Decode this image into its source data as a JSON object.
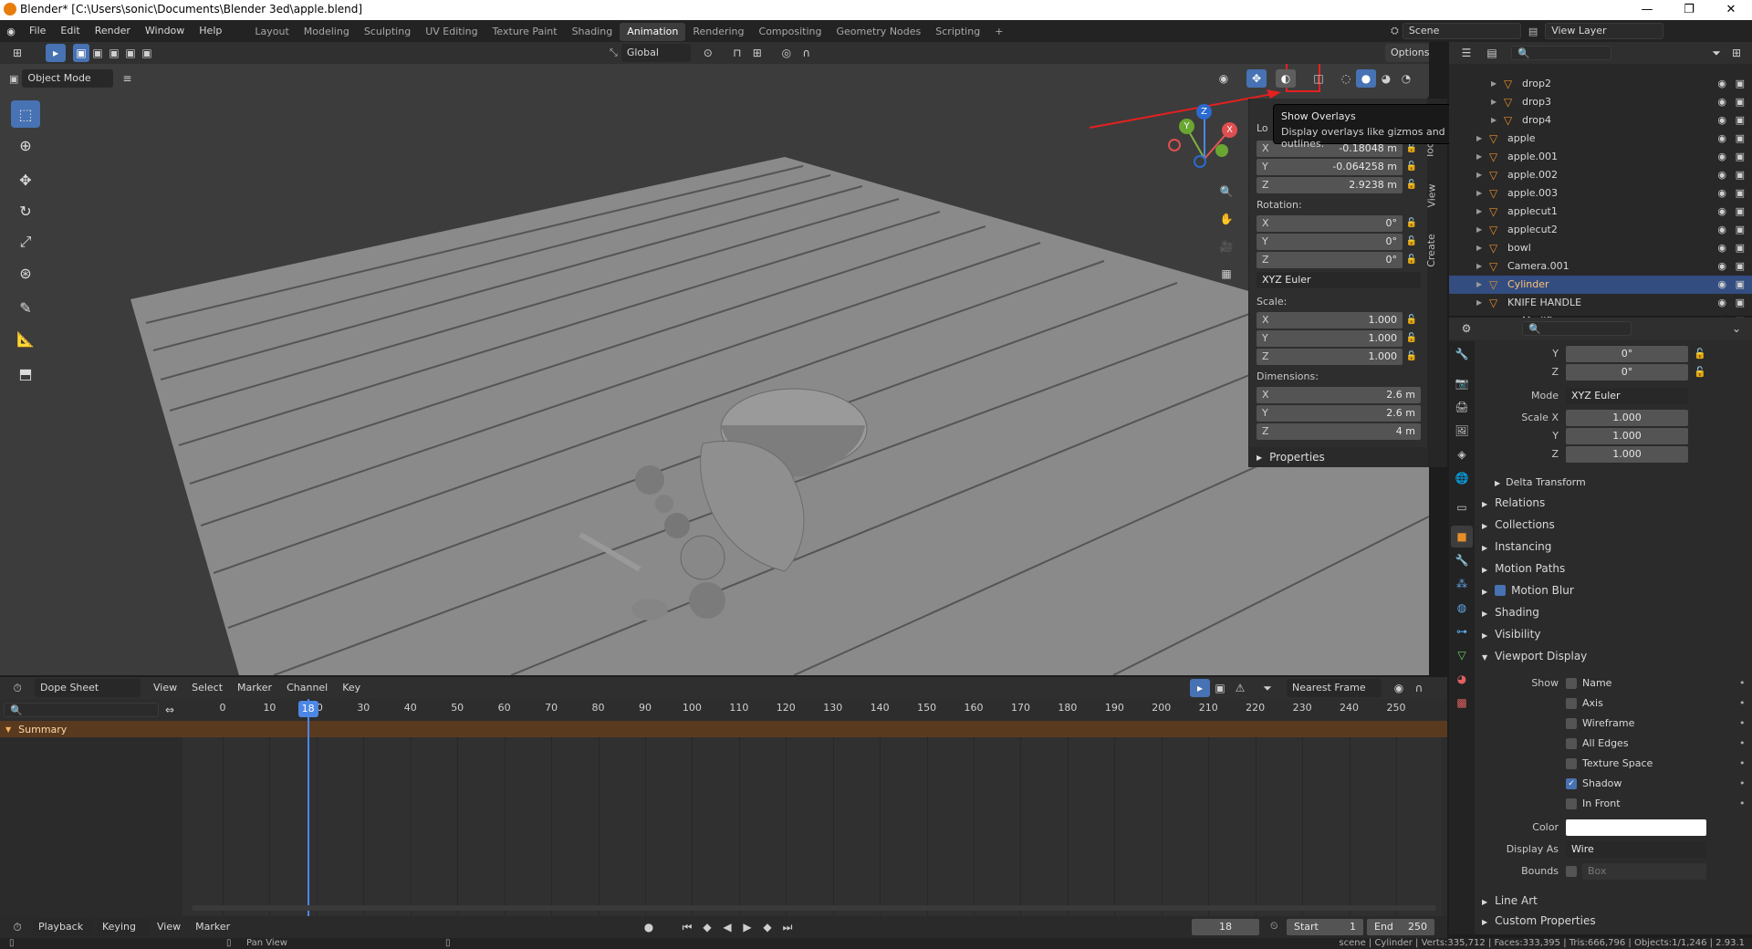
{
  "window": {
    "title": "Blender* [C:\\Users\\sonic\\Documents\\Blender 3ed\\apple.blend]",
    "minimize": "—",
    "maximize": "❐",
    "close": "✕"
  },
  "menu": {
    "items": [
      "File",
      "Edit",
      "Render",
      "Window",
      "Help"
    ],
    "workspaces": [
      "Layout",
      "Modeling",
      "Sculpting",
      "UV Editing",
      "Texture Paint",
      "Shading",
      "Animation",
      "Rendering",
      "Compositing",
      "Geometry Nodes",
      "Scripting"
    ],
    "active_workspace": "Animation",
    "add": "+",
    "scene": "Scene",
    "view_layer": "View Layer"
  },
  "viewport": {
    "mode": "Object Mode",
    "orientation": "Global",
    "options": "Options",
    "gizmo_labels": {
      "x": "X",
      "y": "Y",
      "z": "Z"
    }
  },
  "tooltip": {
    "title": "Show Overlays",
    "desc": "Display overlays like gizmos and outlines."
  },
  "npanel": {
    "location_label": "Lo",
    "location": [
      {
        "axis": "X",
        "value": "-0.18048 m"
      },
      {
        "axis": "Y",
        "value": "-0.064258 m"
      },
      {
        "axis": "Z",
        "value": "2.9238 m"
      }
    ],
    "rotation_label": "Rotation:",
    "rotation": [
      {
        "axis": "X",
        "value": "0°"
      },
      {
        "axis": "Y",
        "value": "0°"
      },
      {
        "axis": "Z",
        "value": "0°"
      }
    ],
    "rot_mode": "XYZ Euler",
    "scale_label": "Scale:",
    "scale": [
      {
        "axis": "X",
        "value": "1.000"
      },
      {
        "axis": "Y",
        "value": "1.000"
      },
      {
        "axis": "Z",
        "value": "1.000"
      }
    ],
    "dimensions_label": "Dimensions:",
    "dimensions": [
      {
        "axis": "X",
        "value": "2.6 m"
      },
      {
        "axis": "Y",
        "value": "2.6 m"
      },
      {
        "axis": "Z",
        "value": "4 m"
      }
    ],
    "properties": "Properties",
    "tabs": [
      "Too",
      "View",
      "Create"
    ]
  },
  "outliner": {
    "rows": [
      {
        "name": "drop2",
        "indent": 2,
        "selected": false
      },
      {
        "name": "drop3",
        "indent": 2,
        "selected": false
      },
      {
        "name": "drop4",
        "indent": 2,
        "selected": false
      },
      {
        "name": "apple",
        "indent": 1,
        "selected": false
      },
      {
        "name": "apple.001",
        "indent": 1,
        "selected": false
      },
      {
        "name": "apple.002",
        "indent": 1,
        "selected": false
      },
      {
        "name": "apple.003",
        "indent": 1,
        "selected": false
      },
      {
        "name": "applecut1",
        "indent": 1,
        "selected": false
      },
      {
        "name": "applecut2",
        "indent": 1,
        "selected": false
      },
      {
        "name": "bowl",
        "indent": 1,
        "selected": false
      },
      {
        "name": "Camera.001",
        "indent": 1,
        "selected": false
      },
      {
        "name": "Cylinder",
        "indent": 1,
        "selected": true
      },
      {
        "name": "KNIFE HANDLE",
        "indent": 1,
        "selected": false
      },
      {
        "name": "Modifiers",
        "indent": 2,
        "selected": false
      }
    ]
  },
  "properties": {
    "rot_y": {
      "label": "Y",
      "value": "0°"
    },
    "rot_z": {
      "label": "Z",
      "value": "0°"
    },
    "mode": {
      "label": "Mode",
      "value": "XYZ Euler"
    },
    "scale_x": {
      "label": "Scale X",
      "value": "1.000"
    },
    "scale_y": {
      "label": "Y",
      "value": "1.000"
    },
    "scale_z": {
      "label": "Z",
      "value": "1.000"
    },
    "delta_transform": "Delta Transform",
    "sections": [
      "Relations",
      "Collections",
      "Instancing",
      "Motion Paths",
      "Motion Blur",
      "Shading",
      "Visibility",
      "Viewport Display"
    ],
    "show_label": "Show",
    "show_options": [
      {
        "label": "Name",
        "checked": false
      },
      {
        "label": "Axis",
        "checked": false
      },
      {
        "label": "Wireframe",
        "checked": false
      },
      {
        "label": "All Edges",
        "checked": false
      },
      {
        "label": "Texture Space",
        "checked": false
      },
      {
        "label": "Shadow",
        "checked": true
      },
      {
        "label": "In Front",
        "checked": false
      }
    ],
    "color_label": "Color",
    "display_as": {
      "label": "Display As",
      "value": "Wire"
    },
    "bounds": {
      "label": "Bounds",
      "value": "Box"
    },
    "line_art": "Line Art",
    "custom_properties": "Custom Properties"
  },
  "dopesheet": {
    "editor": "Dope Sheet",
    "menus": [
      "View",
      "Select",
      "Marker",
      "Channel",
      "Key"
    ],
    "snap": "Nearest Frame",
    "summary": "Summary",
    "ticks": [
      0,
      10,
      20,
      30,
      40,
      50,
      60,
      70,
      80,
      90,
      100,
      110,
      120,
      130,
      140,
      150,
      160,
      170,
      180,
      190,
      200,
      210,
      220,
      230,
      240,
      250
    ],
    "current_frame": 18
  },
  "timeline": {
    "menus": [
      "Playback",
      "Keying",
      "View",
      "Marker"
    ],
    "frame": "18",
    "start_label": "Start",
    "start": "1",
    "end_label": "End",
    "end": "250"
  },
  "status": {
    "hint": "Pan View",
    "stats": "scene | Cylinder | Verts:335,712 | Faces:333,395 | Tris:666,796 | Objects:1/1,246 | 2.93.1"
  }
}
